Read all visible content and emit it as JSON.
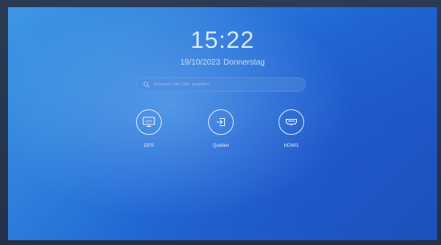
{
  "home": {
    "time": "15:22",
    "date": "19/10/2023",
    "weekday": "Donnerstag"
  },
  "search": {
    "placeholder": "Keyword oder URL eingeben",
    "icon": "search-icon"
  },
  "sources": [
    {
      "label": "OPS",
      "icon": "ops-icon",
      "icon_text": "OPS"
    },
    {
      "label": "Quellen",
      "icon": "input-source-icon"
    },
    {
      "label": "HDMI1",
      "icon": "hdmi-icon"
    }
  ],
  "colors": {
    "screen_blue": "#2f7fdc",
    "screen_light": "#3f97e4",
    "text": "#e6f2ff",
    "bezel": "#2b3b55"
  }
}
